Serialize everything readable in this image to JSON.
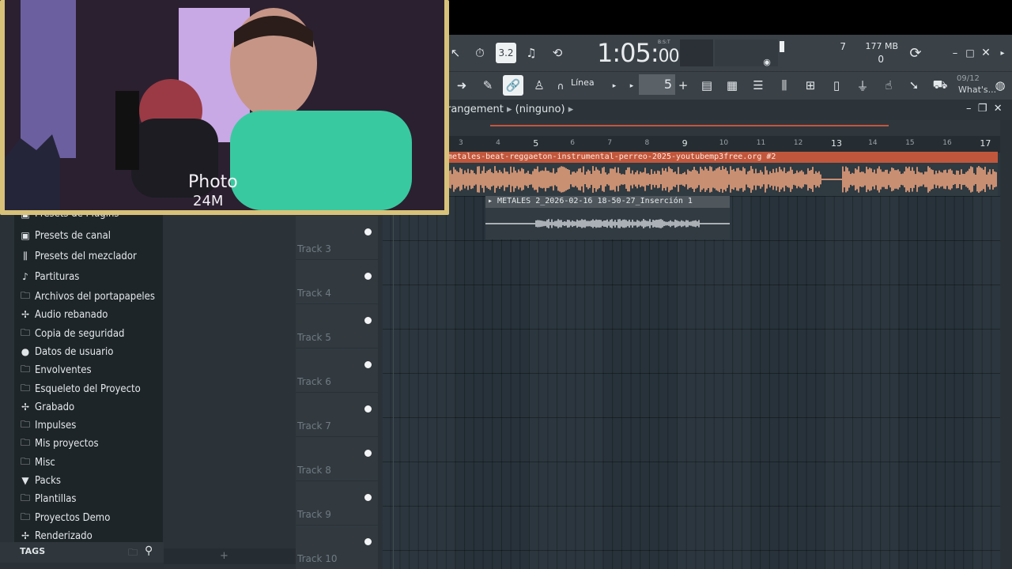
{
  "toolbar": {
    "time_main": "1:05:",
    "time_ticks": "00",
    "time_unit": "B:S:T",
    "cpu_value": "7",
    "memory": "177 MB",
    "polyphony": "0",
    "snap_label": "Línea",
    "step_value": "5",
    "news_date": "09/12",
    "news_label": "What's..."
  },
  "arrangement": {
    "title": "rangement",
    "pattern": "(ninguno)",
    "ruler_ticks": [
      "3",
      "4",
      "5",
      "6",
      "7",
      "8",
      "9",
      "10",
      "11",
      "12",
      "13",
      "14",
      "15",
      "16",
      "17"
    ],
    "clips": [
      {
        "label": "metales-beat-reggaeton-instrumental-perreo-2025-youtubemp3free.org #2",
        "color": "#c0573c"
      },
      {
        "label": "METALES 2_2026-02-16 18-50-27_Inserción 1",
        "color": "#4f575d"
      }
    ]
  },
  "tracks": [
    {
      "name": "Track 3"
    },
    {
      "name": "Track 4"
    },
    {
      "name": "Track 5"
    },
    {
      "name": "Track 6"
    },
    {
      "name": "Track 7"
    },
    {
      "name": "Track 8"
    },
    {
      "name": "Track 9"
    },
    {
      "name": "Track 10"
    }
  ],
  "browser": {
    "items": [
      {
        "label": "Presets de Plugins",
        "icon": "plugin-preset-icon"
      },
      {
        "label": "Presets de canal",
        "icon": "channel-preset-icon"
      },
      {
        "label": "Presets del mezclador",
        "icon": "mixer-preset-icon"
      },
      {
        "label": "Partituras",
        "icon": "note-icon"
      },
      {
        "label": "Archivos del portapapeles",
        "icon": "folder-icon"
      },
      {
        "label": "Audio rebanado",
        "icon": "waveform-icon"
      },
      {
        "label": "Copia de seguridad",
        "icon": "backup-folder-icon"
      },
      {
        "label": "Datos de usuario",
        "icon": "user-icon"
      },
      {
        "label": "Envolventes",
        "icon": "folder-icon"
      },
      {
        "label": "Esqueleto del Proyecto",
        "icon": "folder-icon"
      },
      {
        "label": "Grabado",
        "icon": "waveform-icon"
      },
      {
        "label": "Impulses",
        "icon": "folder-icon"
      },
      {
        "label": "Mis proyectos",
        "icon": "folder-icon"
      },
      {
        "label": "Misc",
        "icon": "folder-icon"
      },
      {
        "label": "Packs",
        "icon": "pack-icon"
      },
      {
        "label": "Plantillas",
        "icon": "folder-icon"
      },
      {
        "label": "Proyectos Demo",
        "icon": "folder-icon"
      },
      {
        "label": "Renderizado",
        "icon": "waveform-icon"
      }
    ],
    "tags_label": "TAGS"
  },
  "webcam": {
    "overlay_text": "Photo",
    "overlay_text2": "24M"
  }
}
